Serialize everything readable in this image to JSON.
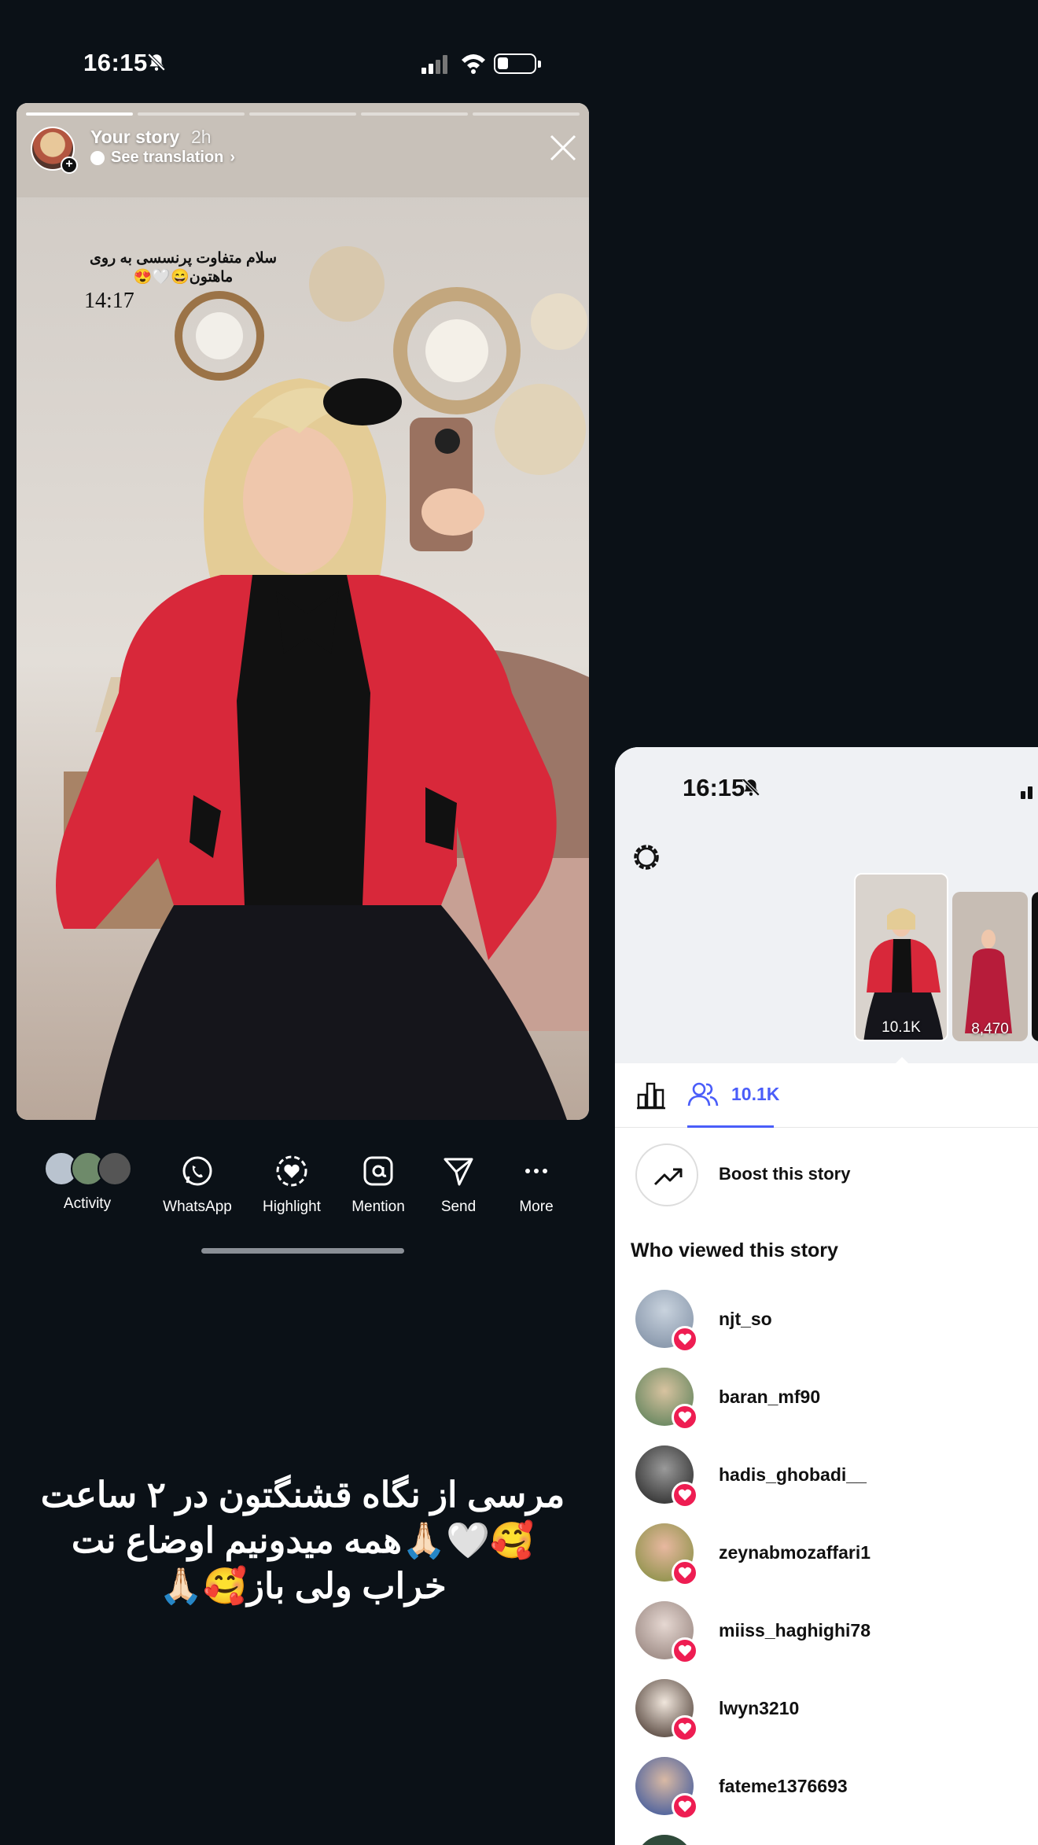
{
  "left_phone": {
    "status": {
      "time": "16:15"
    },
    "story": {
      "user": "Your story",
      "age": "2h",
      "see_translation": "See translation",
      "caption_fa": "سلام متفاوت پرنسسی به روی ماهتون😄🤍😍",
      "caption_time": "14:17"
    },
    "actions": [
      {
        "label": "Activity",
        "icon": "activity-avatars"
      },
      {
        "label": "WhatsApp",
        "icon": "whatsapp-icon"
      },
      {
        "label": "Highlight",
        "icon": "highlight-icon"
      },
      {
        "label": "Mention",
        "icon": "mention-icon"
      },
      {
        "label": "Send",
        "icon": "send-icon"
      },
      {
        "label": "More",
        "icon": "more-icon"
      }
    ],
    "overlay_text": "مرسی از نگاه قشنگتون در ۲ ساعت 🥰🤍🙏🏻همه میدونیم اوضاع نت خراب ولی باز🥰🙏🏻"
  },
  "right_panel": {
    "status": {
      "time": "16:15"
    },
    "thumbs": [
      {
        "count": "10.1K"
      },
      {
        "count": "8,470"
      }
    ],
    "tab_viewers_count": "10.1K",
    "boost_label": "Boost this story",
    "who_viewed": "Who viewed this story",
    "viewers": [
      {
        "name": "njt_so"
      },
      {
        "name": "baran_mf90"
      },
      {
        "name": "hadis_ghobadi__"
      },
      {
        "name": "zeynabmozaffari1"
      },
      {
        "name": "miiss_haghighi78"
      },
      {
        "name": "lwyn3210"
      },
      {
        "name": "fateme1376693"
      }
    ]
  },
  "colors": {
    "background": "#0b1117",
    "accent": "#4a5df9",
    "heart": "#ee1d52",
    "jacket": "#d8283a"
  }
}
